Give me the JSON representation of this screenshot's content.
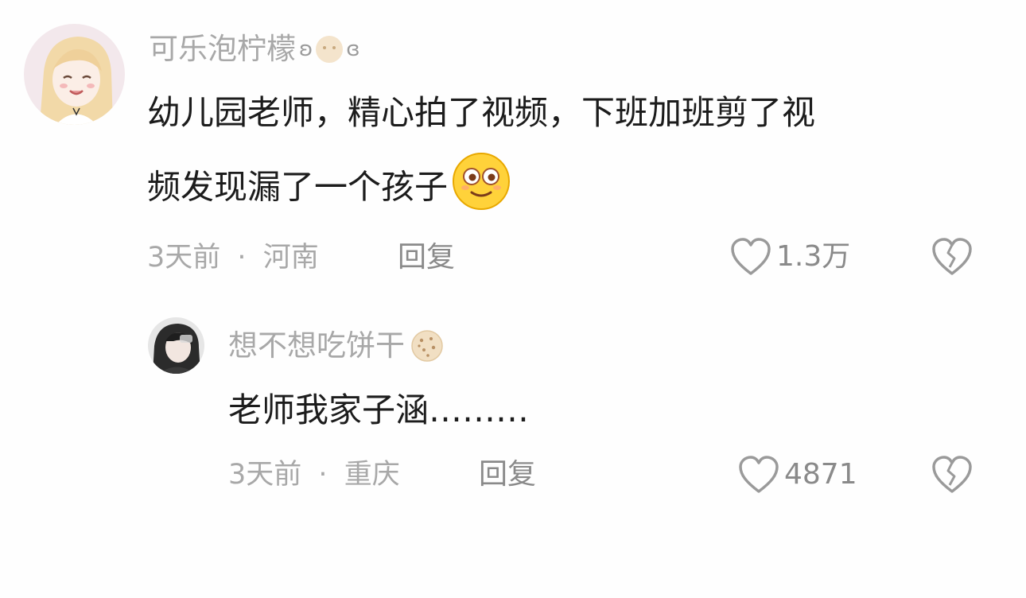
{
  "comments": [
    {
      "username": "可乐泡柠檬",
      "username_suffix_left": "ʚ",
      "username_suffix_right": "ɞ",
      "avatar_icon": "anime-girl-avatar",
      "text_line1": "幼儿园老师，精心拍了视频，下班加班剪了视",
      "text_line2": "频发现漏了一个孩子",
      "emoji": "dizzy-face-emoji",
      "time": "3天前",
      "location": "河南",
      "separator": "·",
      "reply_label": "回复",
      "likes": "1.3万"
    },
    {
      "username": "想不想吃饼干",
      "username_icon": "cookie-icon",
      "avatar_icon": "dark-hair-avatar",
      "text": "老师我家子涵………",
      "time": "3天前",
      "location": "重庆",
      "separator": "·",
      "reply_label": "回复",
      "likes": "4871"
    }
  ],
  "colors": {
    "text": "#1c1c1c",
    "meta": "#a8a8a8",
    "action": "#8a8a8a",
    "background": "#fefefe"
  }
}
